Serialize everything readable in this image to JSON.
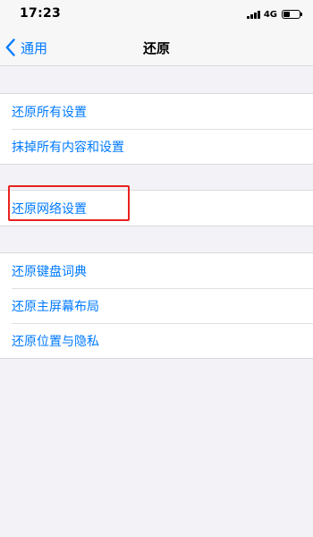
{
  "status_bar": {
    "time": "17:23",
    "network": "4G",
    "icons": [
      "signal-icon",
      "battery-icon"
    ],
    "battery_level": 0.4
  },
  "nav": {
    "back_label": "通用",
    "title": "还原",
    "icons": [
      "chevron-left-icon"
    ]
  },
  "groups": [
    {
      "items": [
        {
          "label": "还原所有设置"
        },
        {
          "label": "抹掉所有内容和设置"
        }
      ]
    },
    {
      "items": [
        {
          "label": "还原网络设置"
        }
      ]
    },
    {
      "items": [
        {
          "label": "还原键盘词典"
        },
        {
          "label": "还原主屏幕布局"
        },
        {
          "label": "还原位置与隐私"
        }
      ]
    }
  ],
  "colors": {
    "accent": "#007aff",
    "background": "#f2f2f7",
    "highlight": "#e8221e"
  }
}
